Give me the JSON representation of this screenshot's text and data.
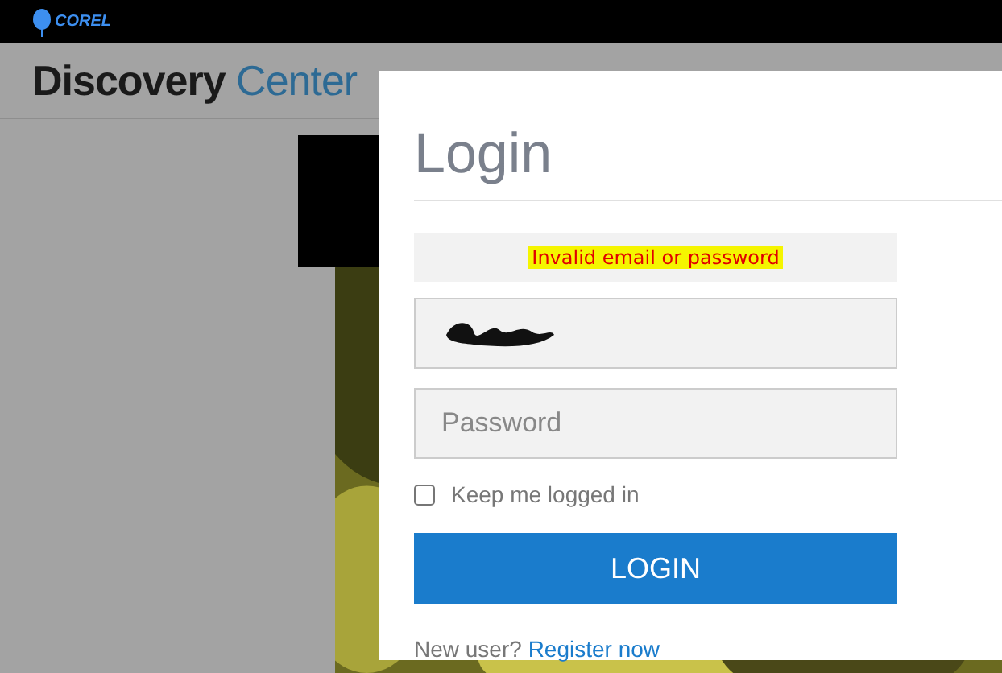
{
  "top_bar": {
    "logo": "COREL"
  },
  "header": {
    "title_bold": "Discovery",
    "title_light": "Center"
  },
  "login_dialog": {
    "title": "Login",
    "error": "Invalid email or password",
    "email_field": {
      "redacted": true
    },
    "password_field": {
      "placeholder": "Password"
    },
    "keep_logged_in": {
      "label": "Keep me logged in",
      "checked": false
    },
    "submit": "LOGIN",
    "footer": {
      "text": "New user?",
      "link": "Register now"
    }
  }
}
